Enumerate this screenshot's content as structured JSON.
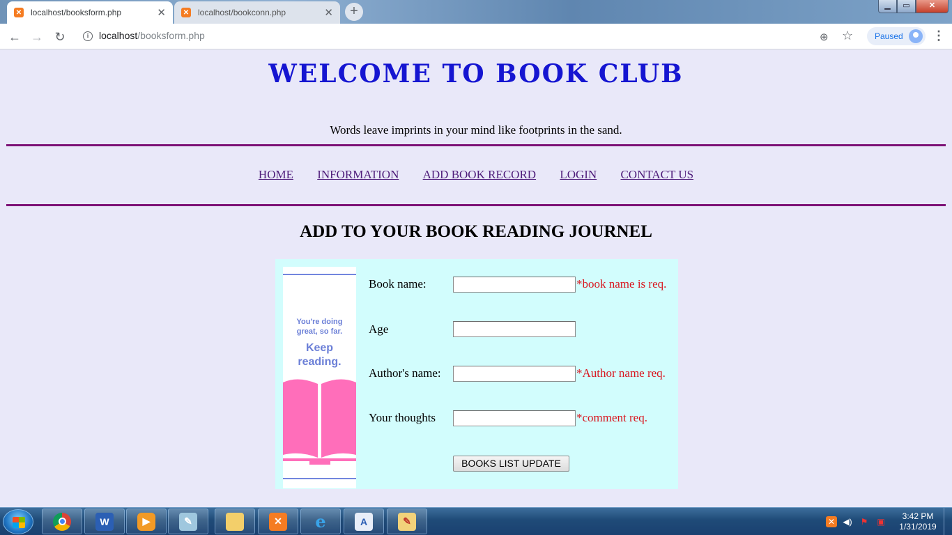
{
  "browser": {
    "tabs": [
      {
        "title": "localhost/booksform.php",
        "active": true
      },
      {
        "title": "localhost/bookconn.php",
        "active": false
      }
    ],
    "new_tab_label": "+",
    "url_host": "localhost",
    "url_path": "/booksform.php",
    "profile_status": "Paused",
    "window_controls": {
      "minimize": "▁",
      "maximize": "▭",
      "close": "✕"
    }
  },
  "page": {
    "title": "WELCOME TO BOOK CLUB",
    "tagline": "Words leave imprints in your mind like footprints in the sand.",
    "nav": [
      "HOME",
      "INFORMATION",
      "ADD BOOK RECORD",
      "LOGIN",
      "CONTACT US"
    ],
    "form_heading": "ADD TO YOUR BOOK READING JOURNEL",
    "bookmark": {
      "line1": "You're doing",
      "line2": "great, so far.",
      "line3": "Keep",
      "line4": "reading."
    },
    "form": {
      "fields": [
        {
          "label": "Book name:",
          "value": "",
          "error": "*book name is req."
        },
        {
          "label": "Age",
          "value": "",
          "error": ""
        },
        {
          "label": "Author's name:",
          "value": "",
          "error": "*Author name req."
        },
        {
          "label": "Your thoughts",
          "value": "",
          "error": "*comment req."
        }
      ],
      "submit_label": "BOOKS LIST UPDATE"
    },
    "colors": {
      "title": "#1515d1",
      "rule": "#7d1277",
      "form_bg": "#d2fdfd",
      "error": "#d9171f",
      "page_bg": "#e9e8f9"
    }
  },
  "taskbar": {
    "apps": [
      "start",
      "chrome",
      "word",
      "media-player",
      "notepad",
      "file-explorer",
      "xampp",
      "internet-explorer",
      "wordpad",
      "paint"
    ],
    "clock_time": "3:42 PM",
    "clock_date": "1/31/2019"
  }
}
